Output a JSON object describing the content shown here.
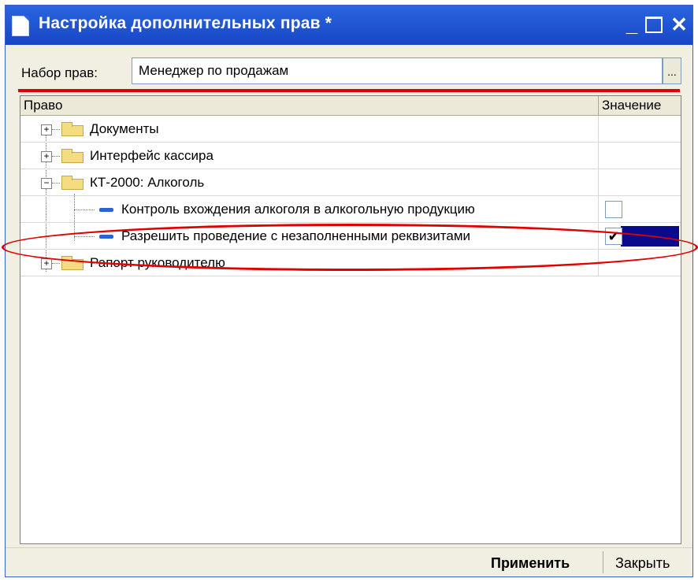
{
  "window": {
    "title": "Настройка дополнительных прав *"
  },
  "titlebar_buttons": {
    "minimize": "_",
    "close": "✕"
  },
  "set": {
    "label": "Набор прав:",
    "value": "Менеджер по продажам",
    "select_button": "..."
  },
  "table": {
    "headers": {
      "name": "Право",
      "value": "Значение"
    },
    "rows": [
      {
        "label": "Документы",
        "type": "folder",
        "expander": "+",
        "checked": null
      },
      {
        "label": "Интерфейс кассира",
        "type": "folder",
        "expander": "+",
        "checked": null
      },
      {
        "label": "КТ-2000: Алкоголь",
        "type": "folder",
        "expander": "−",
        "checked": null
      },
      {
        "label": "Контроль вхождения алкоголя в алкогольную продукцию",
        "type": "item",
        "checked": false
      },
      {
        "label": "Разрешить проведение с незаполненными реквизитами",
        "type": "item",
        "checked": true,
        "selected": true
      },
      {
        "label": "Рапорт руководителю",
        "type": "folder",
        "expander": "+",
        "checked": null
      }
    ]
  },
  "footer": {
    "apply": "Применить",
    "close": "Закрыть"
  },
  "checkmark": "✔",
  "annotations": {
    "highlight_color": "#e00000"
  }
}
